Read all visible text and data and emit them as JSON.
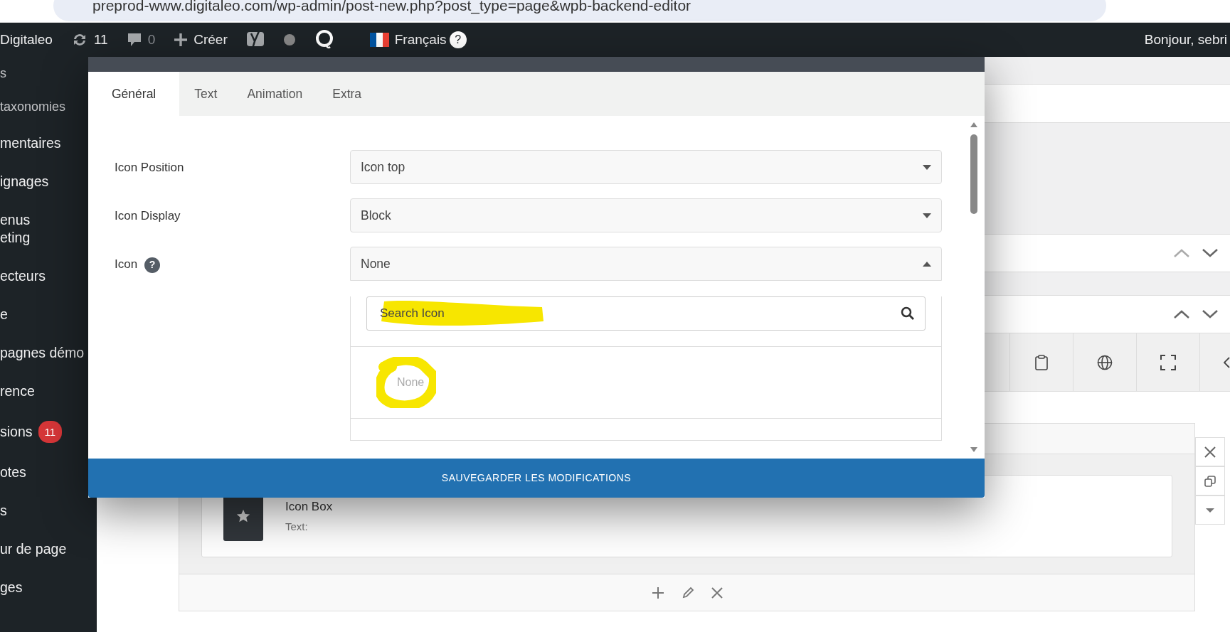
{
  "browser": {
    "url": "preprod-www.digitaleo.com/wp-admin/post-new.php?post_type=page&wpb-backend-editor"
  },
  "admin_bar": {
    "items": [
      {
        "kind": "site",
        "label": "Digitaleo"
      },
      {
        "kind": "updates",
        "label": "11"
      },
      {
        "kind": "comments",
        "label": "0"
      },
      {
        "kind": "new",
        "label": "Créer"
      },
      {
        "kind": "seo"
      },
      {
        "kind": "status_dot"
      },
      {
        "kind": "plugin"
      },
      {
        "kind": "language",
        "label": "Français",
        "help": "?"
      }
    ],
    "greeting": "Bonjour, sebri"
  },
  "sidebar": {
    "items": [
      {
        "lines": [
          "s"
        ],
        "sub": true
      },
      {
        "lines": [
          "taxonomies"
        ],
        "sub": true
      },
      {
        "lines": [
          "mentaires"
        ]
      },
      {
        "lines": [
          "ignages"
        ]
      },
      {
        "lines": [
          "enus",
          "eting"
        ]
      },
      {
        "lines": [
          "ecteurs"
        ]
      },
      {
        "lines": [
          "e"
        ]
      },
      {
        "lines": [
          "pagnes démo"
        ]
      },
      {
        "lines": [
          "rence"
        ]
      },
      {
        "lines": [
          "sions"
        ],
        "badge": "11"
      },
      {
        "lines": [
          "otes"
        ]
      },
      {
        "lines": [
          "s"
        ]
      },
      {
        "lines": [
          "ur de page"
        ]
      },
      {
        "lines": [
          "ges"
        ]
      }
    ]
  },
  "modal": {
    "tabs": [
      {
        "label": "Général",
        "selected": true
      },
      {
        "label": "Text",
        "selected": false
      },
      {
        "label": "Animation",
        "selected": false
      },
      {
        "label": "Extra",
        "selected": false
      }
    ],
    "fields": [
      {
        "label": "Icon Position",
        "value": "Icon top",
        "expanded": false
      },
      {
        "label": "Icon Display",
        "value": "Block",
        "expanded": false
      },
      {
        "label": "Icon",
        "help": "?",
        "value": "None",
        "expanded": true,
        "search": {
          "placeholder": "Search Icon"
        },
        "options": [
          {
            "label": "None"
          }
        ]
      }
    ],
    "save_button": "SAUVEGARDER LES MODIFICATIONS"
  },
  "editor": {
    "element": {
      "title": "Icon Box",
      "subtitle": "Text:"
    }
  }
}
